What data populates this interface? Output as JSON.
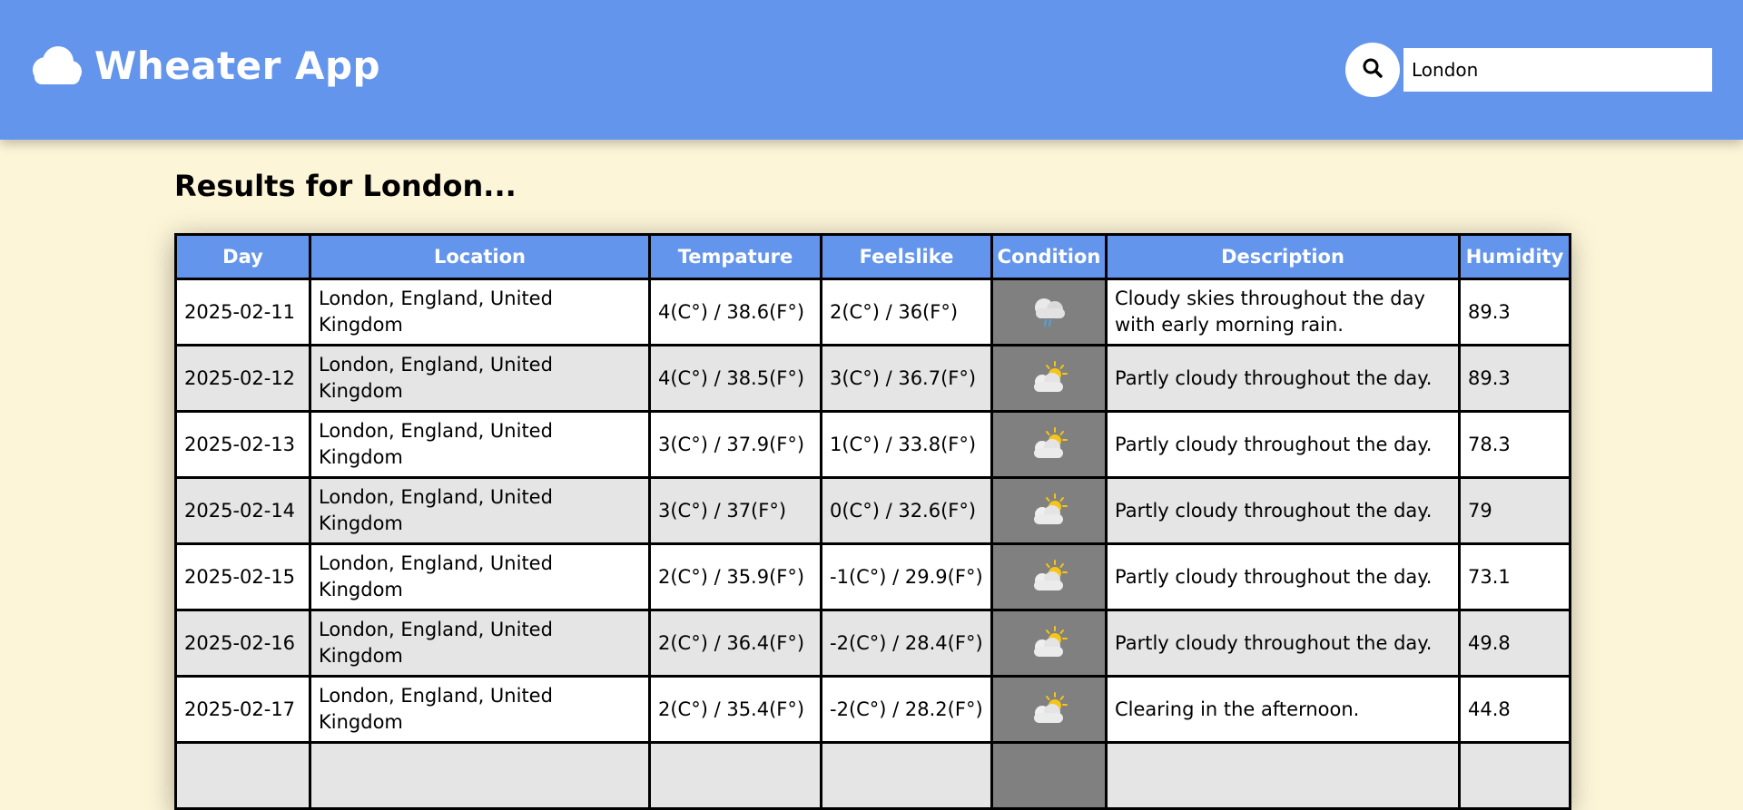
{
  "app": {
    "title": "Wheater App",
    "logo_icon": "cloud-icon"
  },
  "search": {
    "value": "London",
    "icon": "search-icon"
  },
  "results": {
    "heading": "Results for London..."
  },
  "table": {
    "columns": [
      "Day",
      "Location",
      "Tempature",
      "Feelslike",
      "Condition",
      "Description",
      "Humidity"
    ],
    "rows": [
      {
        "day": "2025-02-11",
        "location": "London, England, United Kingdom",
        "temp": "4(C°) / 38.6(F°)",
        "feels": "2(C°) / 36(F°)",
        "condition_icon": "rain-icon",
        "description": "Cloudy skies throughout the day with early morning rain.",
        "humidity": "89.3"
      },
      {
        "day": "2025-02-12",
        "location": "London, England, United Kingdom",
        "temp": "4(C°) / 38.5(F°)",
        "feels": "3(C°) / 36.7(F°)",
        "condition_icon": "partly-cloudy-day-icon",
        "description": "Partly cloudy throughout the day.",
        "humidity": "89.3"
      },
      {
        "day": "2025-02-13",
        "location": "London, England, United Kingdom",
        "temp": "3(C°) / 37.9(F°)",
        "feels": "1(C°) / 33.8(F°)",
        "condition_icon": "partly-cloudy-day-icon",
        "description": "Partly cloudy throughout the day.",
        "humidity": "78.3"
      },
      {
        "day": "2025-02-14",
        "location": "London, England, United Kingdom",
        "temp": "3(C°) / 37(F°)",
        "feels": "0(C°) / 32.6(F°)",
        "condition_icon": "partly-cloudy-day-icon",
        "description": "Partly cloudy throughout the day.",
        "humidity": "79"
      },
      {
        "day": "2025-02-15",
        "location": "London, England, United Kingdom",
        "temp": "2(C°) / 35.9(F°)",
        "feels": "-1(C°) / 29.9(F°)",
        "condition_icon": "partly-cloudy-day-icon",
        "description": "Partly cloudy throughout the day.",
        "humidity": "73.1"
      },
      {
        "day": "2025-02-16",
        "location": "London, England, United Kingdom",
        "temp": "2(C°) / 36.4(F°)",
        "feels": "-2(C°) / 28.4(F°)",
        "condition_icon": "partly-cloudy-day-icon",
        "description": "Partly cloudy throughout the day.",
        "humidity": "49.8"
      },
      {
        "day": "2025-02-17",
        "location": "London, England, United Kingdom",
        "temp": "2(C°) / 35.4(F°)",
        "feels": "-2(C°) / 28.2(F°)",
        "condition_icon": "partly-cloudy-day-icon",
        "description": "Clearing in the afternoon.",
        "humidity": "44.8"
      }
    ]
  },
  "colors": {
    "header": "#6495ed",
    "background": "#fdf5d8",
    "row_alt": "#e5e5e5",
    "condition_cell": "#808080",
    "sun": "#f5c518",
    "rain": "#4fa3e0"
  }
}
